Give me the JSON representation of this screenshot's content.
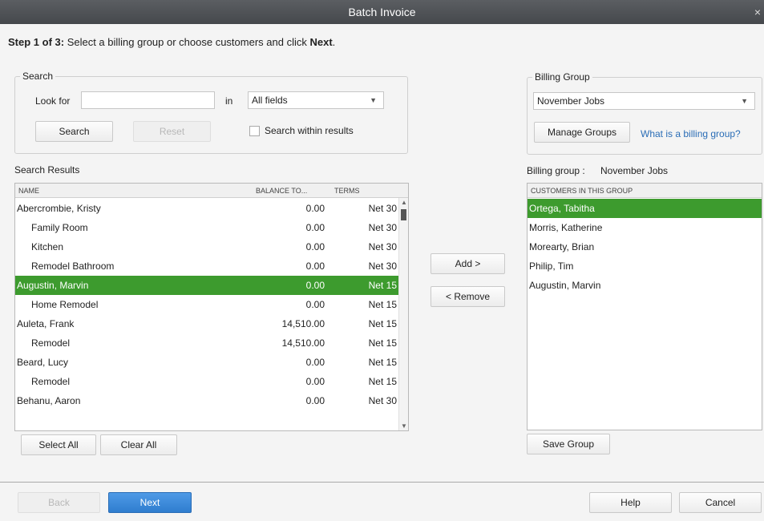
{
  "window": {
    "title": "Batch Invoice",
    "close": "×"
  },
  "step": {
    "prefix": "Step 1 of 3:",
    "text_before": " Select a billing group or choose customers and click ",
    "next_word": "Next",
    "text_after": "."
  },
  "search": {
    "legend": "Search",
    "look_for_label": "Look for",
    "look_for_value": "",
    "in_label": "in",
    "field_select": "All fields",
    "search_button": "Search",
    "reset_button": "Reset",
    "within_label": "Search within results"
  },
  "results": {
    "title": "Search Results",
    "columns": {
      "name": "NAME",
      "balance": "BALANCE TO...",
      "terms": "TERMS"
    },
    "rows": [
      {
        "name": "Abercrombie, Kristy",
        "balance": "0.00",
        "terms": "Net 30"
      },
      {
        "name": "Family Room",
        "balance": "0.00",
        "terms": "Net 30"
      },
      {
        "name": "Kitchen",
        "balance": "0.00",
        "terms": "Net 30"
      },
      {
        "name": "Remodel Bathroom",
        "balance": "0.00",
        "terms": "Net 30"
      },
      {
        "name": "Augustin, Marvin",
        "balance": "0.00",
        "terms": "Net 15"
      },
      {
        "name": "Home Remodel",
        "balance": "0.00",
        "terms": "Net 15"
      },
      {
        "name": "Auleta, Frank",
        "balance": "14,510.00",
        "terms": "Net 15"
      },
      {
        "name": "Remodel",
        "balance": "14,510.00",
        "terms": "Net 15"
      },
      {
        "name": "Beard, Lucy",
        "balance": "0.00",
        "terms": "Net 15"
      },
      {
        "name": "Remodel",
        "balance": "0.00",
        "terms": "Net 15"
      },
      {
        "name": "Behanu, Aaron",
        "balance": "0.00",
        "terms": "Net 30"
      }
    ],
    "select_all": "Select All",
    "clear_all": "Clear All"
  },
  "middle": {
    "add": "Add >",
    "remove": "< Remove"
  },
  "billing": {
    "legend": "Billing Group",
    "selected": "November Jobs",
    "manage_button": "Manage Groups",
    "help_link": "What is a billing group?",
    "group_label": "Billing group :",
    "group_name": "November Jobs",
    "list_header": "CUSTOMERS IN THIS GROUP",
    "customers": [
      "Ortega, Tabitha",
      "Morris, Katherine",
      "Morearty, Brian",
      "Philip, Tim",
      "Augustin, Marvin"
    ],
    "save_button": "Save Group"
  },
  "footer": {
    "back": "Back",
    "next": "Next",
    "help": "Help",
    "cancel": "Cancel"
  },
  "colors": {
    "selection": "#3d9b2e",
    "link": "#2a6db6",
    "primary": "#2f7dcf"
  }
}
